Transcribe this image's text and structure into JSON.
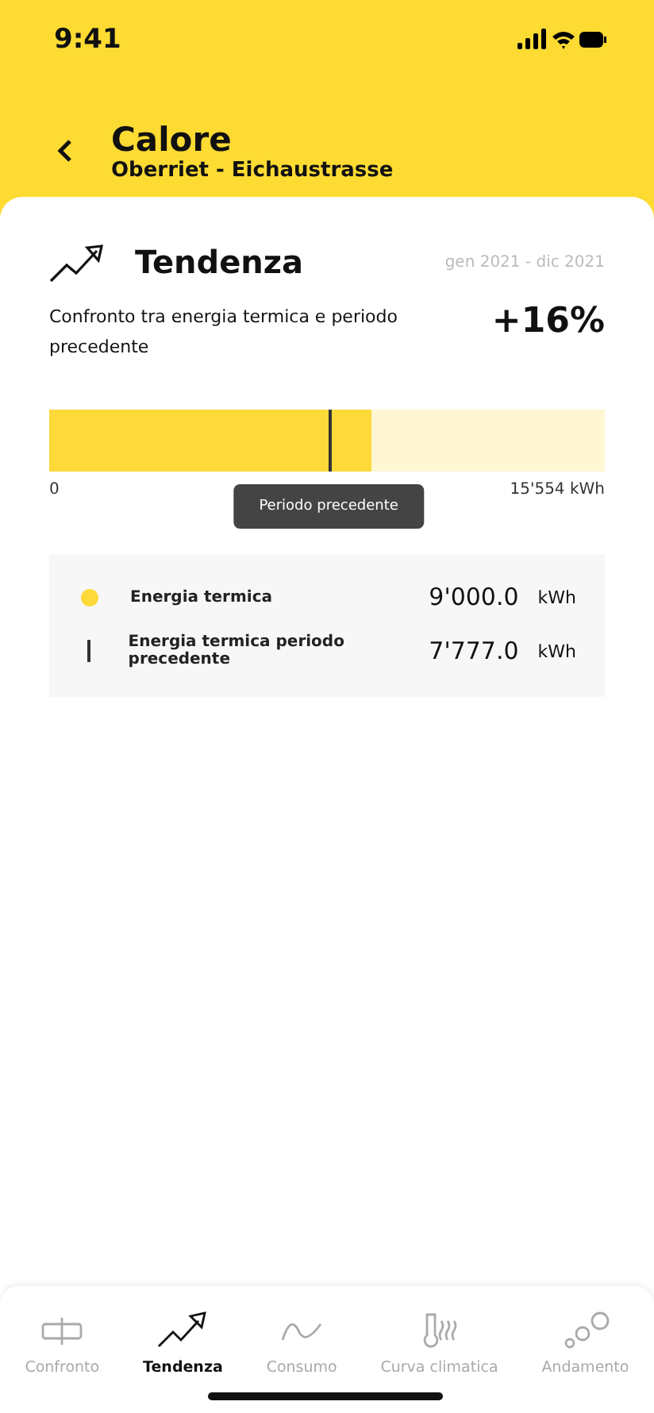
{
  "status_bar": {
    "time": "9:41"
  },
  "header": {
    "title": "Calore",
    "subtitle": "Oberriet - Eichaustrasse"
  },
  "card": {
    "title": "Tendenza",
    "period": "gen 2021 - dic 2021",
    "description": "Confronto tra energia termica e periodo precedente",
    "change": "+16%",
    "bar": {
      "fill": {
        "level": 0.58
      },
      "marker": {
        "level": 0.503
      },
      "min_label": "0",
      "max_label": "15'554 kWh",
      "tooltip": "Periodo precedente"
    },
    "legend": [
      {
        "kind": "dot",
        "label": "Energia termica",
        "value": "9'000.0",
        "unit": "kWh"
      },
      {
        "kind": "line",
        "label": "Energia termica periodo precedente",
        "value": "7'777.0",
        "unit": "kWh"
      }
    ]
  },
  "tabs": [
    {
      "kind": "compare",
      "label": "Confronto",
      "selected": false
    },
    {
      "kind": "trend",
      "label": "Tendenza",
      "selected": true
    },
    {
      "kind": "wave",
      "label": "Consumo",
      "selected": false
    },
    {
      "kind": "thermo",
      "label": "Curva climatica",
      "selected": false
    },
    {
      "kind": "bubbles",
      "label": "Andamento",
      "selected": false
    }
  ]
}
